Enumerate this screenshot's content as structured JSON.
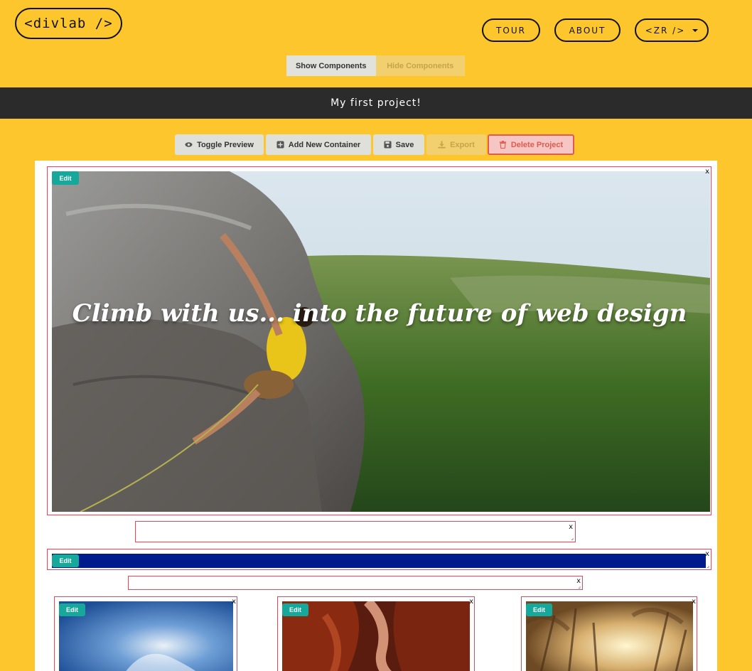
{
  "header": {
    "logo": "<divlab />",
    "nav": {
      "tour": "TOUR",
      "about": "ABOUT",
      "user": "<ZR />"
    }
  },
  "components_toggle": {
    "show": "Show Components",
    "hide": "Hide Components"
  },
  "project": {
    "title": "My first project!"
  },
  "toolbar": {
    "toggle_preview": "Toggle Preview",
    "add_container": "Add New Container",
    "save": "Save",
    "export": "Export",
    "delete_project": "Delete Project"
  },
  "canvas": {
    "hero": {
      "edit": "Edit",
      "close": "x",
      "title": "Climb with us... into the future of web design"
    },
    "text_box_1": {
      "close": "x"
    },
    "banner": {
      "edit": "Edit",
      "close": "x",
      "color": "#001c8c"
    },
    "text_box_2": {
      "close": "x"
    },
    "cards": [
      {
        "edit": "Edit",
        "close": "x",
        "icon": "sky-image"
      },
      {
        "edit": "Edit",
        "close": "x",
        "icon": "canyon-image"
      },
      {
        "edit": "Edit",
        "close": "x",
        "icon": "grass-image"
      }
    ]
  },
  "colors": {
    "background": "#fcc62c",
    "project_bar": "#2b2b2b",
    "edit_badge": "#16a89a",
    "outline": "#e8475a",
    "delete": "#e05a4e"
  }
}
